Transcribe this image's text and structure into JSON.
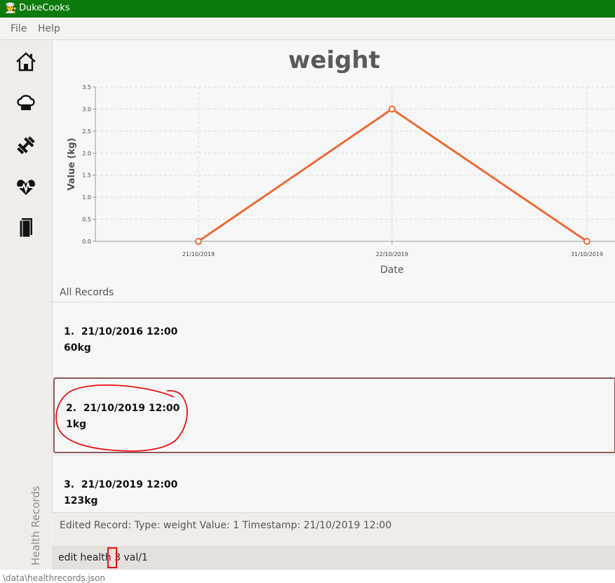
{
  "window": {
    "title": "DukeCooks"
  },
  "menu": {
    "file": "File",
    "help": "Help"
  },
  "sidebar": {
    "items": [
      {
        "icon": "house-icon"
      },
      {
        "icon": "chef-hat-icon"
      },
      {
        "icon": "dumbbell-icon"
      },
      {
        "icon": "heart-pulse-icon"
      },
      {
        "icon": "book-icon"
      }
    ],
    "section_label": "Health Records"
  },
  "chart_data": {
    "type": "line",
    "title": "weight",
    "xlabel": "Date",
    "ylabel": "Value (kg)",
    "categories": [
      "21/10/2019",
      "22/10/2019",
      "31/10/2019"
    ],
    "values": [
      0.0,
      3.0,
      0.0
    ],
    "ylim": [
      0,
      3.5
    ],
    "yticks": [
      "0.0",
      "0.5",
      "1.0",
      "1.5",
      "2.0",
      "2.5",
      "3.0",
      "3.5"
    ],
    "grid": true,
    "line_color": "#ee6a35"
  },
  "records": {
    "header": "All Records",
    "items": [
      {
        "index": "1.",
        "timestamp": "21/10/2016 12:00",
        "value": "60kg"
      },
      {
        "index": "2.",
        "timestamp": "21/10/2019 12:00",
        "value": "1kg"
      },
      {
        "index": "3.",
        "timestamp": "21/10/2019 12:00",
        "value": "123kg"
      }
    ]
  },
  "result": {
    "text": "Edited Record: Type: weight Value: 1 Timestamp: 21/10/2019 12:00"
  },
  "command": {
    "value": "edit health 3 val/1"
  },
  "status": {
    "path": "\\data\\healthrecords.json"
  },
  "colors": {
    "titlebar": "#0c7a0c",
    "annotation": "#e81010",
    "line": "#ee6a35"
  }
}
